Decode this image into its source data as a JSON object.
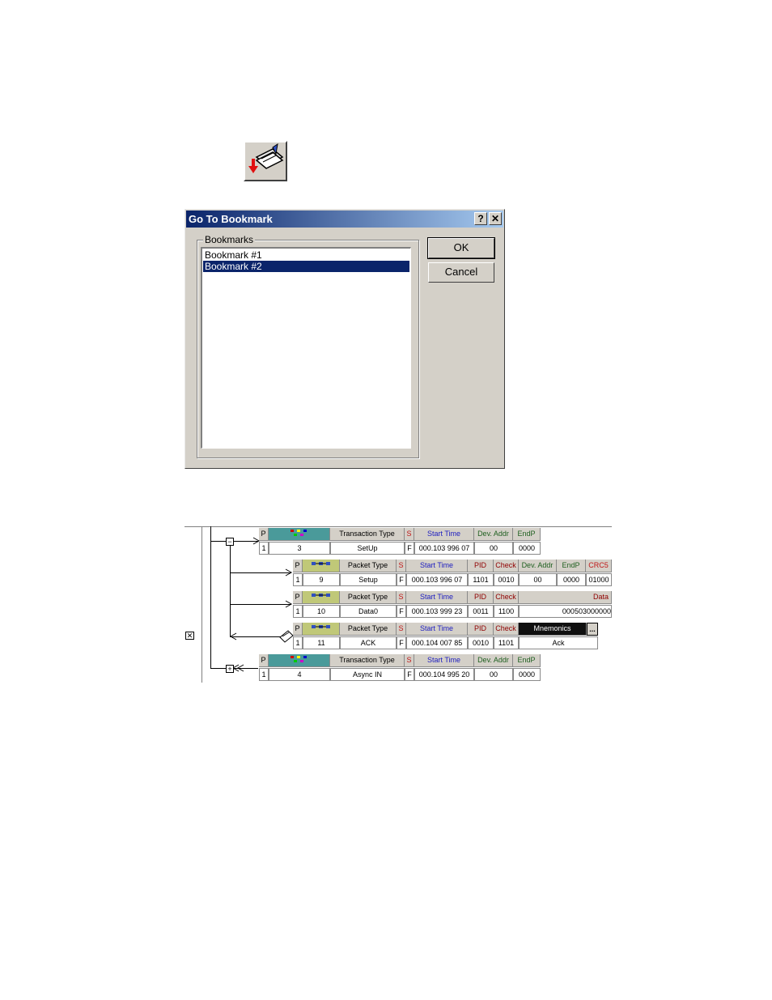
{
  "toolbar": {
    "icon": "goto-bookmark-icon"
  },
  "dialog": {
    "title": "Go To Bookmark",
    "help_glyph": "?",
    "close_glyph": "✕",
    "group_label": "Bookmarks",
    "items": [
      "Bookmark #1",
      "Bookmark #2"
    ],
    "selected_index": 1,
    "ok_label": "OK",
    "cancel_label": "Cancel"
  },
  "trace": {
    "transaction1": {
      "h_p": "P",
      "h_type": "Transaction Type",
      "h_s": "S",
      "h_start": "Start Time",
      "h_dev": "Dev. Addr",
      "h_endp": "EndP",
      "v_p": "1",
      "v_num": "3",
      "v_type": "SetUp",
      "v_s": "F",
      "v_start": "000.103 996 07",
      "v_dev": "00",
      "v_endp": "0000"
    },
    "packet1": {
      "h_p": "P",
      "h_type": "Packet Type",
      "h_s": "S",
      "h_start": "Start Time",
      "h_pid": "PID",
      "h_check": "Check",
      "h_dev": "Dev. Addr",
      "h_endp": "EndP",
      "h_crc": "CRC5",
      "v_p": "1",
      "v_num": "9",
      "v_type": "Setup",
      "v_s": "F",
      "v_start": "000.103 996 07",
      "v_pid": "1101",
      "v_check": "0010",
      "v_dev": "00",
      "v_endp": "0000",
      "v_crc": "01000"
    },
    "packet2": {
      "h_p": "P",
      "h_type": "Packet Type",
      "h_s": "S",
      "h_start": "Start Time",
      "h_pid": "PID",
      "h_check": "Check",
      "h_data": "Data",
      "v_p": "1",
      "v_num": "10",
      "v_type": "Data0",
      "v_s": "F",
      "v_start": "000.103 999 23",
      "v_pid": "0011",
      "v_check": "1100",
      "v_data": "000503000000"
    },
    "packet3": {
      "h_p": "P",
      "h_type": "Packet Type",
      "h_s": "S",
      "h_start": "Start Time",
      "h_pid": "PID",
      "h_check": "Check",
      "h_mnem": "Mnemonics",
      "h_more": "...",
      "v_p": "1",
      "v_num": "11",
      "v_type": "ACK",
      "v_s": "F",
      "v_start": "000.104 007 85",
      "v_pid": "0010",
      "v_check": "1101",
      "v_mnem": "Ack"
    },
    "transaction2": {
      "h_p": "P",
      "h_type": "Transaction Type",
      "h_s": "S",
      "h_start": "Start Time",
      "h_dev": "Dev. Addr",
      "h_endp": "EndP",
      "v_p": "1",
      "v_num": "4",
      "v_type": "Async IN",
      "v_s": "F",
      "v_start": "000.104 995 20",
      "v_dev": "00",
      "v_endp": "0000"
    },
    "collapse_glyph": "−",
    "expand_glyph": "+",
    "close_marker": "✕"
  }
}
